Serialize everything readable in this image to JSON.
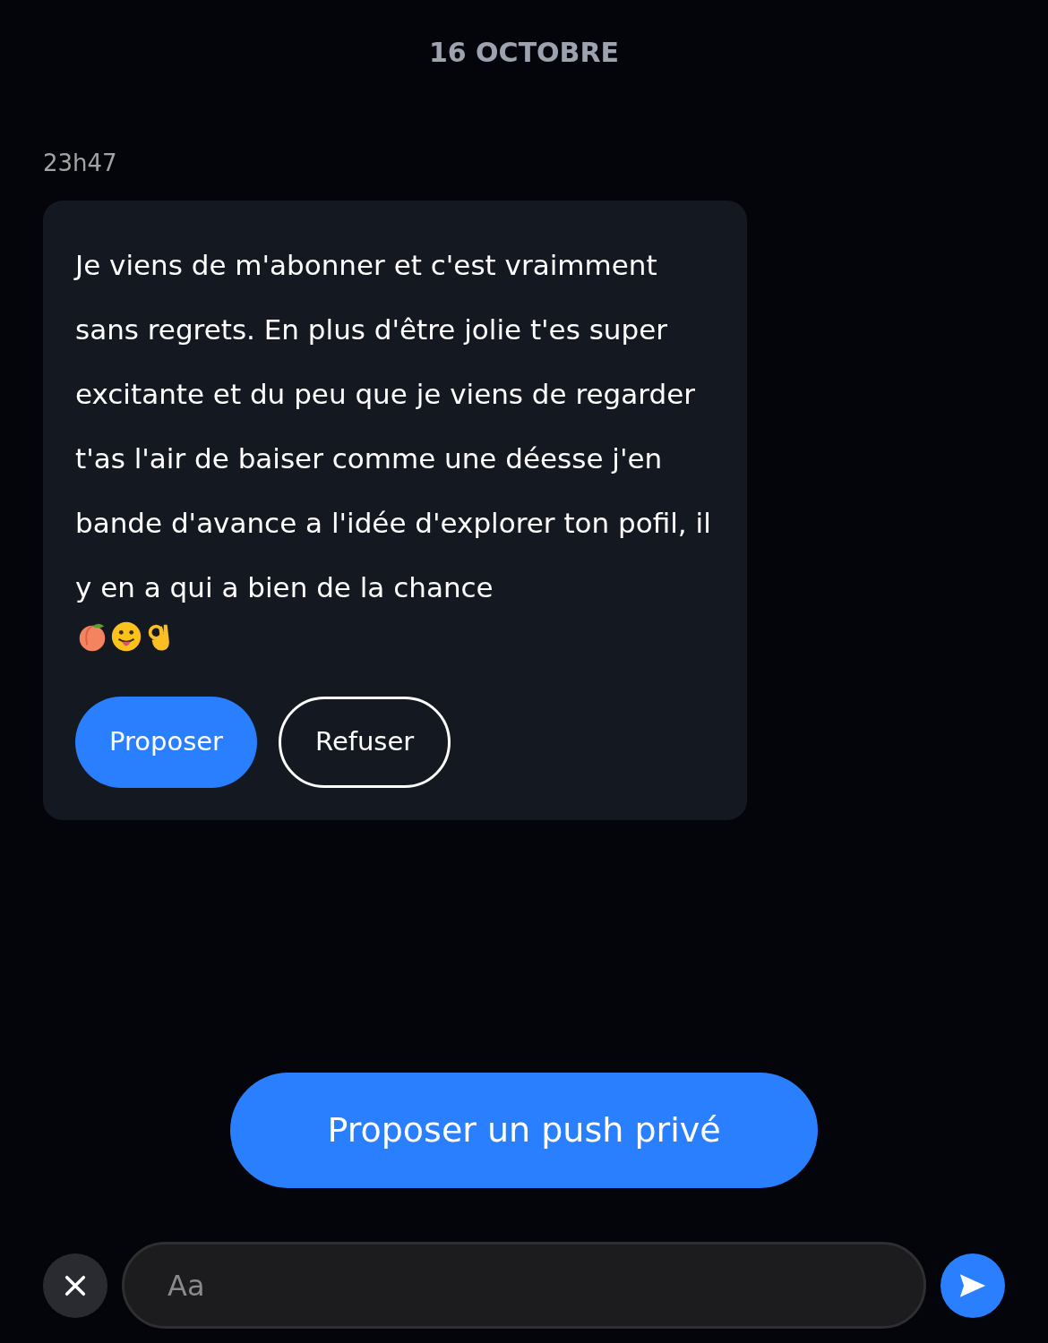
{
  "date_header": "16 OCTOBRE",
  "message": {
    "time": "23h47",
    "text": "Je viens de m'abonner et c'est vraimment sans regrets. En plus d'être jolie t'es super excitante et du peu que je viens de regarder t'as l'air de baiser comme une déesse j'en bande d'avance a l'idée d'explorer ton pofil, il y en a qui a bien de la chance",
    "actions": [
      {
        "label": "Proposer",
        "kind": "primary"
      },
      {
        "label": "Refuser",
        "kind": "outline"
      }
    ]
  },
  "push_button": "Proposer un push privé",
  "composer": {
    "placeholder": "Aa"
  }
}
